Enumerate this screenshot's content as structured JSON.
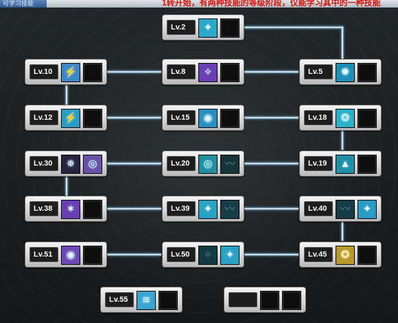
{
  "header": {
    "tab_label": "可学习技能",
    "notice": "1转开始，有两种技能的等级阶段，仅能学习其中的一种技能"
  },
  "colors": {
    "link_line": "#dff2ff",
    "glow": "#8fd6ff",
    "card_light": "#f4f4f4",
    "card_dark": "#b9b9b9"
  },
  "skills": [
    {
      "id": "lv2",
      "level": "Lv.2",
      "slots": [
        {
          "icon": "wind-blade-icon",
          "glyph": "✦",
          "color": "#2aa7c9"
        },
        {
          "icon": "empty",
          "glyph": "",
          "color": "#0e0e0e"
        }
      ]
    },
    {
      "id": "lv5",
      "level": "Lv.5",
      "slots": [
        {
          "icon": "aura-burst-icon",
          "glyph": "✺",
          "color": "#1f8fb8"
        },
        {
          "icon": "empty",
          "glyph": "",
          "color": "#0e0e0e"
        }
      ]
    },
    {
      "id": "lv8",
      "level": "Lv.8",
      "slots": [
        {
          "icon": "shadow-strike-icon",
          "glyph": "✧",
          "color": "#6b3fb3"
        },
        {
          "icon": "empty",
          "glyph": "",
          "color": "#0e0e0e"
        }
      ]
    },
    {
      "id": "lv10",
      "level": "Lv.10",
      "slots": [
        {
          "icon": "slash-icon",
          "glyph": "⚡",
          "color": "#3d86c8"
        },
        {
          "icon": "empty",
          "glyph": "",
          "color": "#0e0e0e"
        }
      ]
    },
    {
      "id": "lv12",
      "level": "Lv.12",
      "slots": [
        {
          "icon": "lightning-icon",
          "glyph": "⚡",
          "color": "#2d9cc4"
        },
        {
          "icon": "empty",
          "glyph": "",
          "color": "#0e0e0e"
        }
      ]
    },
    {
      "id": "lv15",
      "level": "Lv.15",
      "slots": [
        {
          "icon": "orb-icon",
          "glyph": "◉",
          "color": "#2a8fc0"
        },
        {
          "icon": "empty",
          "glyph": "",
          "color": "#0e0e0e"
        }
      ]
    },
    {
      "id": "lv18",
      "level": "Lv.18",
      "slots": [
        {
          "icon": "shield-burst-icon",
          "glyph": "❂",
          "color": "#2ab0c8"
        },
        {
          "icon": "empty",
          "glyph": "",
          "color": "#0e0e0e"
        }
      ]
    },
    {
      "id": "lv19",
      "level": "Lv.19",
      "slots": [
        {
          "icon": "tornado-icon",
          "glyph": "▲",
          "color": "#1f8fa8"
        },
        {
          "icon": "empty",
          "glyph": "",
          "color": "#0e0e0e"
        }
      ]
    },
    {
      "id": "lv20",
      "level": "Lv.20",
      "slots": [
        {
          "icon": "spiral-icon",
          "glyph": "◎",
          "color": "#1f8fa0"
        },
        {
          "icon": "dark-slash-icon",
          "glyph": "〰",
          "color": "#17343d"
        }
      ]
    },
    {
      "id": "lv30",
      "level": "Lv.30",
      "slots": [
        {
          "icon": "dark-ritual-icon",
          "glyph": "✵",
          "color": "#2a2340"
        },
        {
          "icon": "void-portal-icon",
          "glyph": "◎",
          "color": "#6b4fa8"
        }
      ]
    },
    {
      "id": "lv38",
      "level": "Lv.38",
      "slots": [
        {
          "icon": "demon-summon-icon",
          "glyph": "✶",
          "color": "#6b3fb3"
        },
        {
          "icon": "empty",
          "glyph": "",
          "color": "#0e0e0e"
        }
      ]
    },
    {
      "id": "lv39",
      "level": "Lv.39",
      "slots": [
        {
          "icon": "blade-storm-icon",
          "glyph": "✦",
          "color": "#2aa2c6"
        },
        {
          "icon": "dark-blade-icon",
          "glyph": "〰",
          "color": "#173e48"
        }
      ]
    },
    {
      "id": "lv40",
      "level": "Lv.40",
      "slots": [
        {
          "icon": "shadow-wing-icon",
          "glyph": "〰",
          "color": "#183c46"
        },
        {
          "icon": "spear-strike-icon",
          "glyph": "✦",
          "color": "#2a9bc6"
        }
      ]
    },
    {
      "id": "lv45",
      "level": "Lv.45",
      "slots": [
        {
          "icon": "golden-relic-icon",
          "glyph": "✪",
          "color": "#b89a2a"
        },
        {
          "icon": "empty",
          "glyph": "",
          "color": "#0e0e0e"
        }
      ]
    },
    {
      "id": "lv50",
      "level": "Lv.50",
      "slots": [
        {
          "icon": "abyss-claw-icon",
          "glyph": "✧",
          "color": "#143a44"
        },
        {
          "icon": "ice-sword-icon",
          "glyph": "✦",
          "color": "#2aa2c6"
        }
      ]
    },
    {
      "id": "lv51",
      "level": "Lv.51",
      "slots": [
        {
          "icon": "purple-aura-icon",
          "glyph": "◉",
          "color": "#6e48b8"
        },
        {
          "icon": "empty",
          "glyph": "",
          "color": "#0e0e0e"
        }
      ]
    },
    {
      "id": "lv55",
      "level": "Lv.55",
      "slots": [
        {
          "icon": "wind-wave-icon",
          "glyph": "≋",
          "color": "#3aa6d0"
        },
        {
          "icon": "empty",
          "glyph": "",
          "color": "#0e0e0e"
        }
      ]
    },
    {
      "id": "blank",
      "level": "",
      "slots": [
        {
          "icon": "empty",
          "glyph": "",
          "color": "#0e0e0e"
        },
        {
          "icon": "empty",
          "glyph": "",
          "color": "#0e0e0e"
        }
      ]
    }
  ]
}
